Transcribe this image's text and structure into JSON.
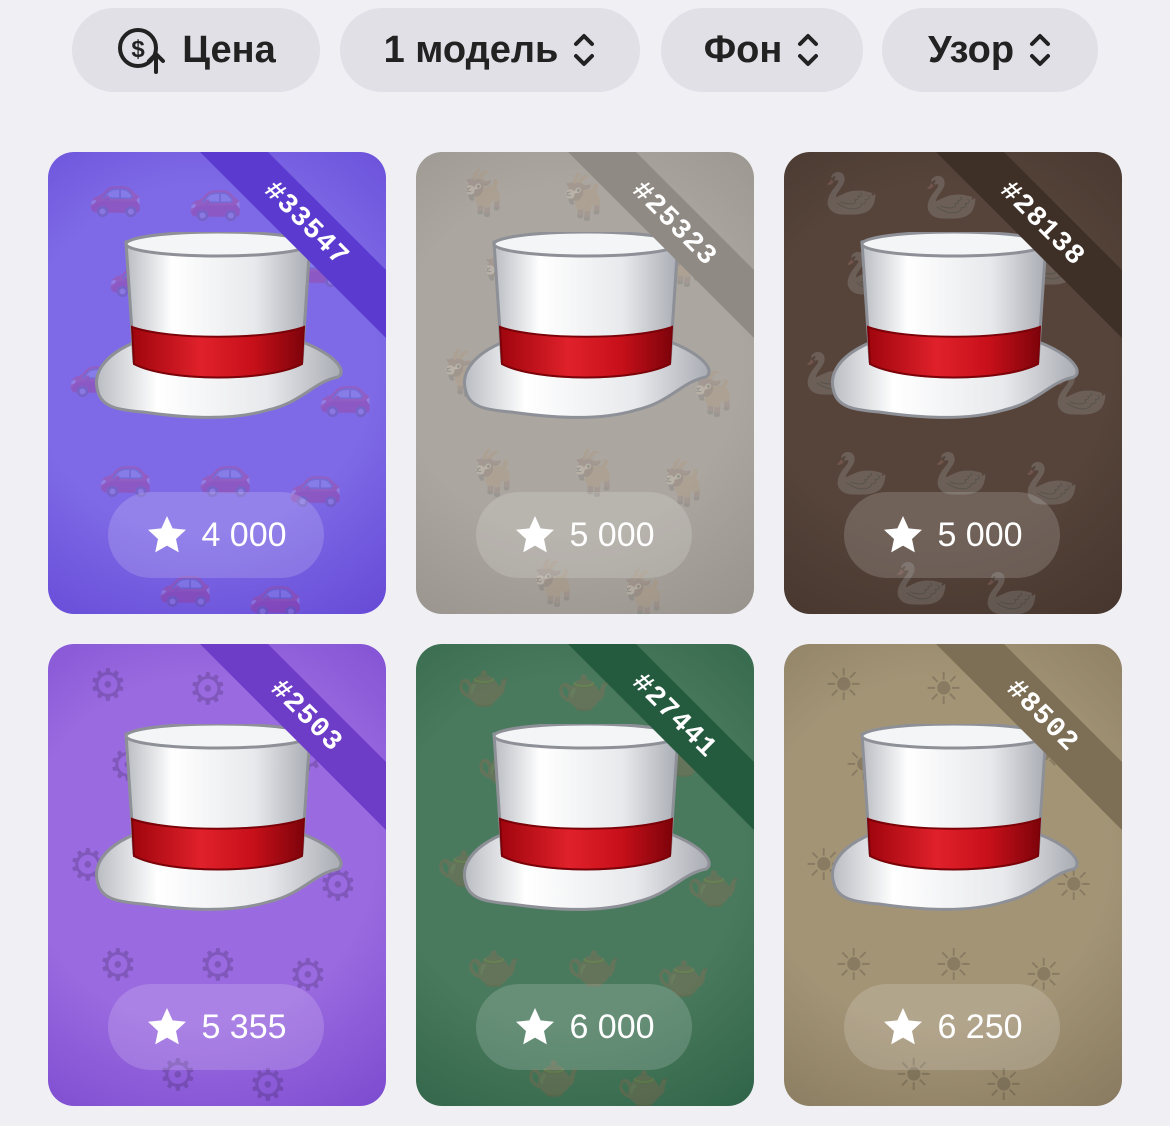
{
  "filters": {
    "price_label": "Цена",
    "model_label": "1 модель",
    "background_label": "Фон",
    "pattern_label": "Узор"
  },
  "cards": [
    {
      "number": "#33547",
      "price": "4 000",
      "bg": "#7e6ae6",
      "ribbon": "#5b3bcf",
      "pattern_icon": "car-icon"
    },
    {
      "number": "#25323",
      "price": "5 000",
      "bg": "#aba69f",
      "ribbon": "#8f8a83",
      "pattern_icon": "goat-icon"
    },
    {
      "number": "#28138",
      "price": "5 000",
      "bg": "#56443a",
      "ribbon": "#3e2f27",
      "pattern_icon": "swan-icon"
    },
    {
      "number": "#2503",
      "price": "5 355",
      "bg": "#9a6ae0",
      "ribbon": "#6e3dc8",
      "pattern_icon": "gear-icon"
    },
    {
      "number": "#27441",
      "price": "6 000",
      "bg": "#4a7a5e",
      "ribbon": "#245a3e",
      "pattern_icon": "teapot-icon"
    },
    {
      "number": "#8502",
      "price": "6 250",
      "bg": "#a39476",
      "ribbon": "#7d6f55",
      "pattern_icon": "sun-icon"
    }
  ]
}
